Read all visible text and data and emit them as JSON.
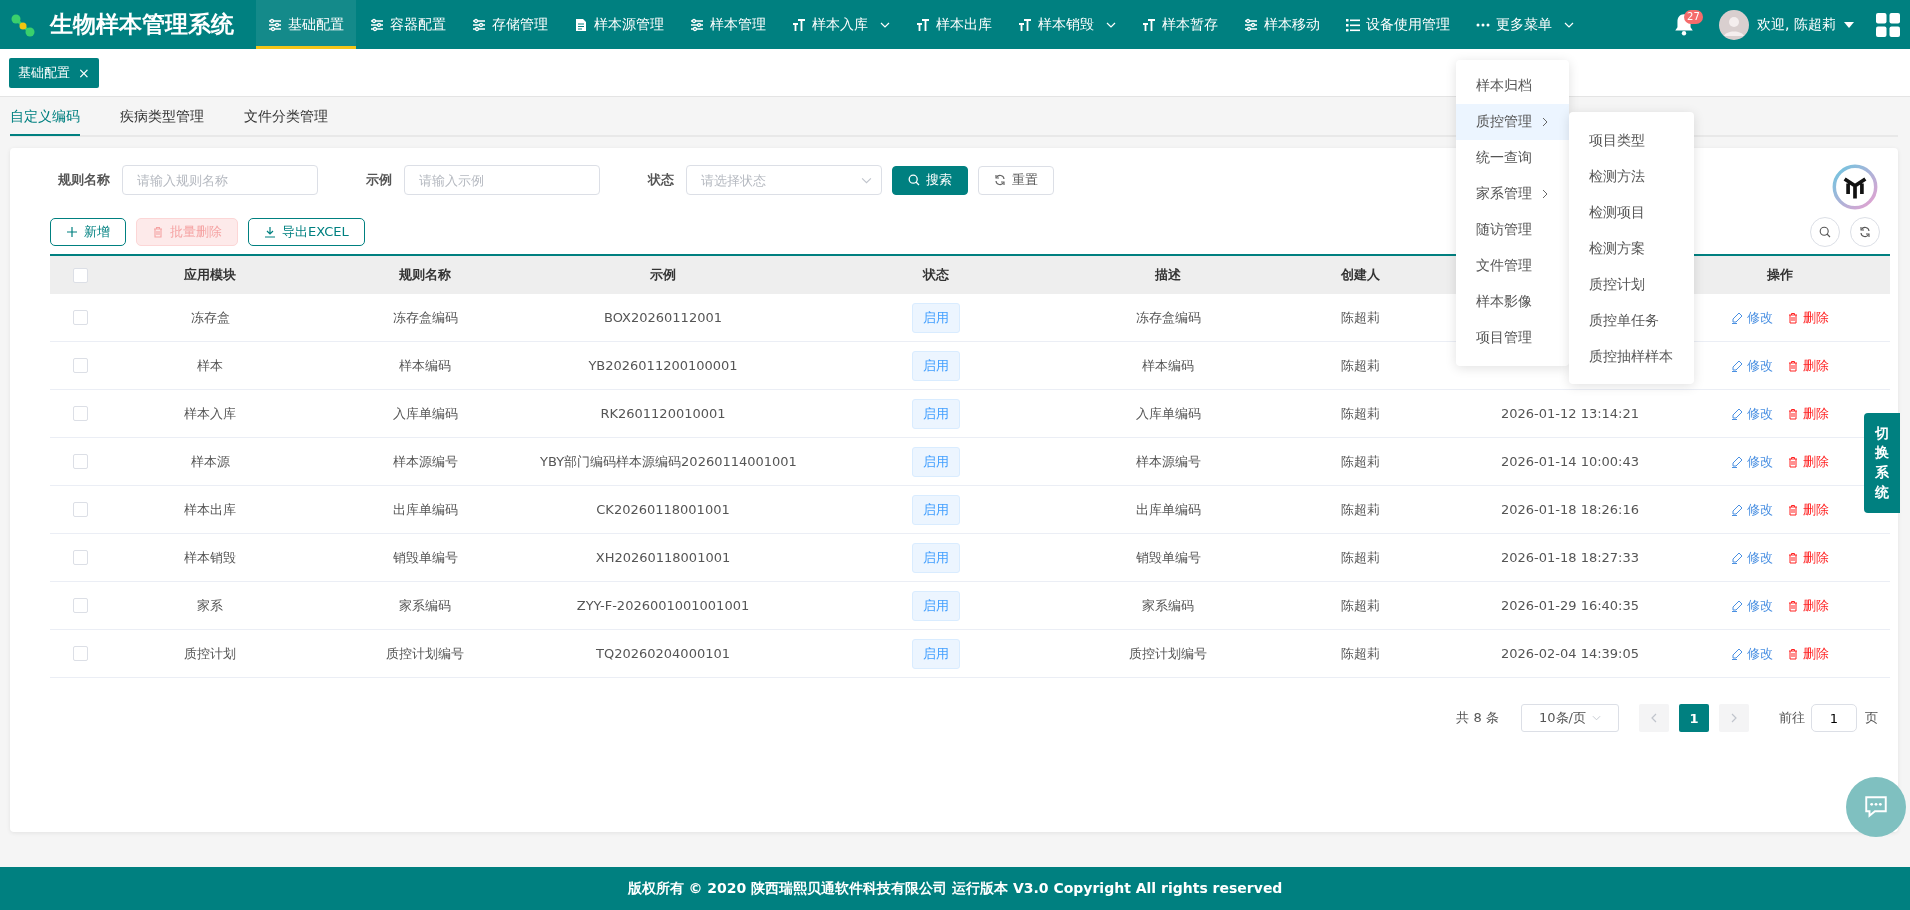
{
  "app": {
    "title": "生物样本管理系统"
  },
  "nav": [
    {
      "label": "基础配置",
      "kind": "sliders",
      "selected": true,
      "caret": false
    },
    {
      "label": "容器配置",
      "kind": "sliders",
      "selected": false,
      "caret": false
    },
    {
      "label": "存储管理",
      "kind": "sliders",
      "selected": false,
      "caret": false
    },
    {
      "label": "样本源管理",
      "kind": "doc",
      "selected": false,
      "caret": false
    },
    {
      "label": "样本管理",
      "kind": "sliders",
      "selected": false,
      "caret": false
    },
    {
      "label": "样本入库",
      "kind": "text",
      "selected": false,
      "caret": true
    },
    {
      "label": "样本出库",
      "kind": "text",
      "selected": false,
      "caret": false
    },
    {
      "label": "样本销毁",
      "kind": "text",
      "selected": false,
      "caret": true
    },
    {
      "label": "样本暂存",
      "kind": "text",
      "selected": false,
      "caret": false
    },
    {
      "label": "样本移动",
      "kind": "sliders",
      "selected": false,
      "caret": false
    },
    {
      "label": "设备使用管理",
      "kind": "list",
      "selected": false,
      "caret": false
    },
    {
      "label": "更多菜单",
      "kind": "dots",
      "selected": false,
      "caret": true
    }
  ],
  "user": {
    "notification_count": "27",
    "greeting": "欢迎, 陈超莉"
  },
  "open_tabs": [
    {
      "label": "基础配置",
      "close": "×"
    }
  ],
  "sub_tabs": [
    {
      "label": "自定义编码",
      "selected": true
    },
    {
      "label": "疾病类型管理",
      "selected": false
    },
    {
      "label": "文件分类管理",
      "selected": false
    }
  ],
  "filters": [
    {
      "label": "规则名称",
      "kind": "input",
      "placeholder": "请输入规则名称"
    },
    {
      "label": "示例",
      "kind": "input",
      "placeholder": "请输入示例"
    },
    {
      "label": "状态",
      "kind": "select",
      "placeholder": "请选择状态"
    }
  ],
  "filter_buttons": [
    {
      "label": "搜索",
      "kind": "primary"
    },
    {
      "label": "重置",
      "kind": "plain"
    }
  ],
  "toolbar": [
    {
      "label": "新增",
      "kind": "add",
      "disabled": false
    },
    {
      "label": "批量删除",
      "kind": "delete",
      "disabled": true
    },
    {
      "label": "导出EXCEL",
      "kind": "export",
      "disabled": false
    }
  ],
  "table": {
    "select_all_checked": false,
    "columns": [
      "应用模块",
      "规则名称",
      "示例",
      "状态",
      "描述",
      "创建人",
      "操作"
    ],
    "rows": [
      {
        "checked": false,
        "module": "冻存盒",
        "rule": "冻存盒编码",
        "example": "BOX20260112001",
        "status": "启用",
        "description": "冻存盒编码",
        "creator": "陈超莉",
        "edit": "修改",
        "delete": "删除"
      },
      {
        "checked": false,
        "module": "样本",
        "rule": "样本编码",
        "example": "YB2026011200100001",
        "status": "启用",
        "description": "样本编码",
        "creator": "陈超莉",
        "edit": "修改",
        "delete": "删除"
      },
      {
        "checked": false,
        "module": "样本入库",
        "rule": "入库单编码",
        "example": "RK2601120010001",
        "status": "启用",
        "description": "入库单编码",
        "creator": "陈超莉",
        "created": "2026-01-12 13:14:21",
        "edit": "修改",
        "delete": "删除"
      },
      {
        "checked": false,
        "module": "样本源",
        "rule": "样本源编号",
        "example": "YBY部门编码样本源编码20260114001001",
        "status": "启用",
        "description": "样本源编号",
        "creator": "陈超莉",
        "created": "2026-01-14 10:00:43",
        "edit": "修改",
        "delete": "删除"
      },
      {
        "checked": false,
        "module": "样本出库",
        "rule": "出库单编码",
        "example": "CK20260118001001",
        "status": "启用",
        "description": "出库单编码",
        "creator": "陈超莉",
        "created": "2026-01-18 18:26:16",
        "edit": "修改",
        "delete": "删除"
      },
      {
        "checked": false,
        "module": "样本销毁",
        "rule": "销毁单编号",
        "example": "XH20260118001001",
        "status": "启用",
        "description": "销毁单编号",
        "creator": "陈超莉",
        "created": "2026-01-18 18:27:33",
        "edit": "修改",
        "delete": "删除"
      },
      {
        "checked": false,
        "module": "家系",
        "rule": "家系编码",
        "example": "ZYY-F-2026001001001001",
        "status": "启用",
        "description": "家系编码",
        "creator": "陈超莉",
        "created": "2026-01-29 16:40:35",
        "edit": "修改",
        "delete": "删除"
      },
      {
        "checked": false,
        "module": "质控计划",
        "rule": "质控计划编号",
        "example": "TQ20260204000101",
        "status": "启用",
        "description": "质控计划编号",
        "creator": "陈超莉",
        "created": "2026-02-04 14:39:05",
        "edit": "修改",
        "delete": "删除"
      }
    ]
  },
  "pagination": {
    "total": "共 8 条",
    "page_size": "10条/页",
    "pages": [
      {
        "label": "1",
        "selected": true
      }
    ],
    "goto_label": "前往",
    "goto_value": "1",
    "goto_suffix": "页"
  },
  "more_menu": {
    "expanded": true,
    "items": [
      {
        "label": "样本归档",
        "submenu": false,
        "selected": false
      },
      {
        "label": "质控管理",
        "submenu": true,
        "selected": true
      },
      {
        "label": "统一查询",
        "submenu": false,
        "selected": false
      },
      {
        "label": "家系管理",
        "submenu": true,
        "selected": false
      },
      {
        "label": "随访管理",
        "submenu": false,
        "selected": false
      },
      {
        "label": "文件管理",
        "submenu": false,
        "selected": false
      },
      {
        "label": "样本影像",
        "submenu": false,
        "selected": false
      },
      {
        "label": "项目管理",
        "submenu": false,
        "selected": false
      }
    ],
    "submenu": [
      "项目类型",
      "检测方法",
      "检测项目",
      "检测方案",
      "质控计划",
      "质控单任务",
      "质控抽样样本"
    ]
  },
  "switch_system": "切换系统",
  "footer": "版权所有 © 2020 陕西瑞熙贝通软件科技有限公司 运行版本 V3.0 Copyright All rights reserved"
}
